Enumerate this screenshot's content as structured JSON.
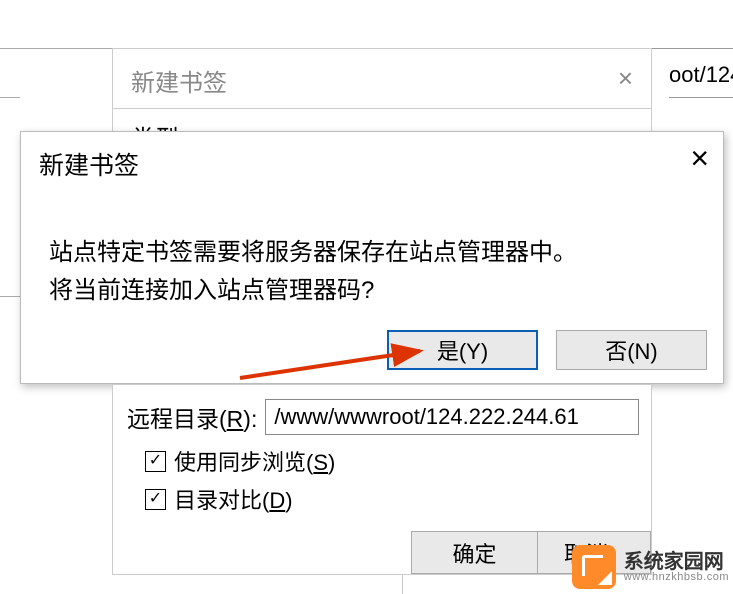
{
  "window_behind": {
    "title": "新建书签",
    "type_label": "类型",
    "remote_path_fragment": "oot/124"
  },
  "confirm_dialog": {
    "title": "新建书签",
    "message_line1": "站点特定书签需要将服务器保存在站点管理器中。",
    "message_line2": "将当前连接加入站点管理器码?",
    "yes_button": "是(Y)",
    "no_button": "否(N)"
  },
  "lower_panel": {
    "remote_label_pre": "远程目录(",
    "remote_label_key": "R",
    "remote_label_post": "):",
    "remote_path": "/www/wwwroot/124.222.244.61",
    "sync_browse_pre": "使用同步浏览(",
    "sync_browse_key": "S",
    "sync_browse_post": ")",
    "dir_compare_pre": "目录对比(",
    "dir_compare_key": "D",
    "dir_compare_post": ")",
    "sync_browse_checked": true,
    "dir_compare_checked": true,
    "ok_button": "确定",
    "cancel_button": "取消"
  },
  "watermark": {
    "main": "系统家园网",
    "sub": "www.hnzkhbsb.com"
  },
  "icons": {
    "close_x": "×",
    "check": "✓"
  }
}
